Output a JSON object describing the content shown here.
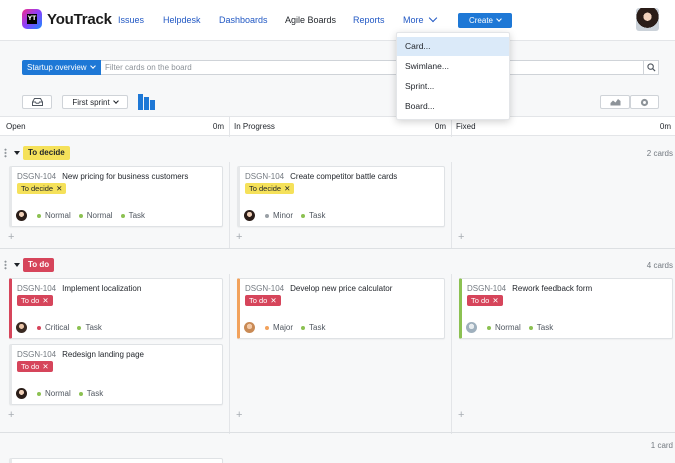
{
  "app": {
    "name": "YouTrack",
    "logo_mark": "YT"
  },
  "nav": {
    "links": [
      "Issues",
      "Helpdesk",
      "Dashboards",
      "Agile Boards",
      "Reports"
    ],
    "more": "More",
    "create": "Create"
  },
  "board": {
    "selector": "Startup overview",
    "filter_placeholder": "Filter cards on the board",
    "sprint": "First sprint"
  },
  "columns": [
    {
      "name": "Open",
      "time": "0m"
    },
    {
      "name": "In Progress",
      "time": "0m"
    },
    {
      "name": "Fixed",
      "time": "0m"
    }
  ],
  "swimlanes": [
    {
      "name": "To decide",
      "count": "2 cards",
      "color": "#f5e15a"
    },
    {
      "name": "To do",
      "count": "4 cards",
      "color": "#d6455b"
    },
    {
      "count": "1 card"
    }
  ],
  "cards": [
    {
      "id": "DSGN-104",
      "title": "New pricing for business customers",
      "tag": "To decide",
      "fields": [
        "Normal",
        "Normal",
        "Task"
      ]
    },
    {
      "id": "DSGN-104",
      "title": "Create competitor battle cards",
      "tag": "To decide",
      "fields": [
        "Minor",
        "Task"
      ]
    },
    {
      "id": "DSGN-104",
      "title": "Implement localization",
      "tag": "To do",
      "fields": [
        "Critical",
        "Task"
      ]
    },
    {
      "id": "DSGN-104",
      "title": "Redesign landing page",
      "tag": "To do",
      "fields": [
        "Normal",
        "Task"
      ]
    },
    {
      "id": "DSGN-104",
      "title": "Develop new price calculator",
      "tag": "To do",
      "fields": [
        "Major",
        "Task"
      ]
    },
    {
      "id": "DSGN-104",
      "title": "Rework feedback form",
      "tag": "To do",
      "fields": [
        "Normal",
        "Task"
      ]
    }
  ],
  "dropdown": {
    "items": [
      "Card...",
      "Swimlane...",
      "Sprint...",
      "Board..."
    ],
    "highlighted": "Card..."
  },
  "colors": {
    "accent": "#1e78d6",
    "link": "#2158c4",
    "todo_tag": "#d6455b",
    "decide_tag": "#f5e15a",
    "normal": "#8cc152",
    "critical": "#d6455b",
    "minor": "#9aa0a6",
    "major": "#f2a25c",
    "task": "#8cc152"
  }
}
